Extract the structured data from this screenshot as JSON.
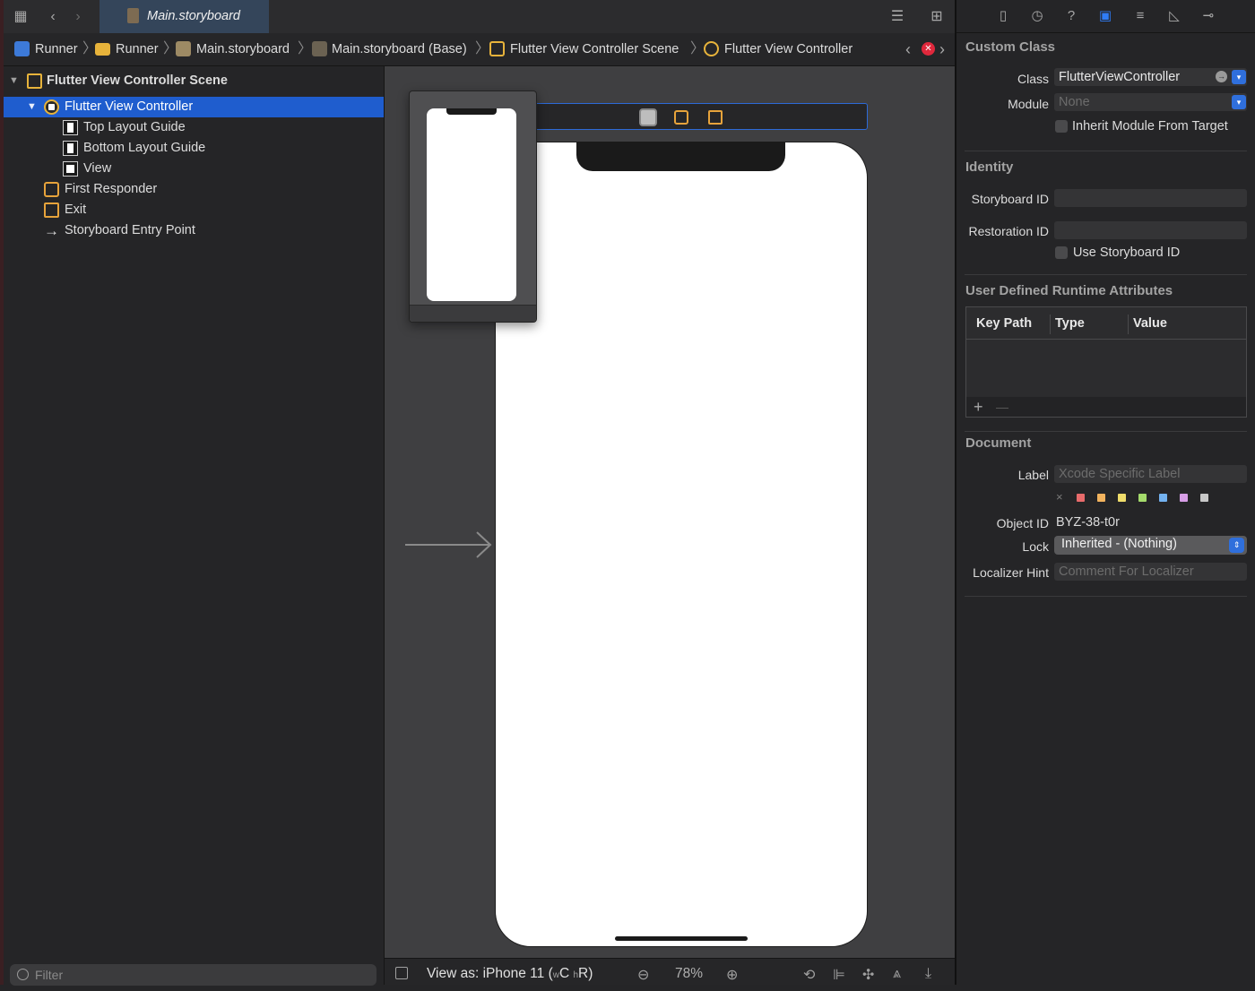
{
  "tabbar": {
    "active_tab": "Main.storyboard"
  },
  "breadcrumb": {
    "items": [
      "Runner",
      "Runner",
      "Main.storyboard",
      "Main.storyboard (Base)",
      "Flutter View Controller Scene",
      "Flutter View Controller"
    ]
  },
  "outline": {
    "rows": [
      "Flutter View Controller Scene",
      "Flutter View Controller",
      "Top Layout Guide",
      "Bottom Layout Guide",
      "View",
      "First Responder",
      "Exit",
      "Storyboard Entry Point"
    ],
    "selected_index": 1,
    "filter_placeholder": "Filter"
  },
  "canvas_toolbar": {
    "view_as": "View as: iPhone 11 (",
    "size_w": "w",
    "size_c": "C",
    "size_h": "h",
    "size_r": "R",
    "close_paren": ")",
    "zoom": "78%"
  },
  "inspector": {
    "custom_class": {
      "title": "Custom Class",
      "class_label": "Class",
      "class_value": "FlutterViewController",
      "module_label": "Module",
      "module_placeholder": "None",
      "inherit_label": "Inherit Module From Target"
    },
    "identity": {
      "title": "Identity",
      "storyboard_id_label": "Storyboard ID",
      "restoration_id_label": "Restoration ID",
      "use_storyboard_id_label": "Use Storyboard ID"
    },
    "runtime_attrs": {
      "title": "User Defined Runtime Attributes",
      "columns": [
        "Key Path",
        "Type",
        "Value"
      ],
      "add": "+",
      "remove": "—"
    },
    "document": {
      "title": "Document",
      "label_label": "Label",
      "label_placeholder": "Xcode Specific Label",
      "clear_glyph": "×",
      "object_id_label": "Object ID",
      "object_id_value": "BYZ-38-t0r",
      "lock_label": "Lock",
      "lock_value": "Inherited - (Nothing)",
      "localizer_hint_label": "Localizer Hint",
      "localizer_hint_placeholder": "Comment For Localizer"
    }
  },
  "colors": {
    "selection": "#1f5dce",
    "accent": "#2f6fdc",
    "scene_icon": "#e7b33b",
    "label_swatches": [
      "#e86b6b",
      "#f2b35e",
      "#f0dd6b",
      "#a5db6c",
      "#73b2f0",
      "#d79ee6",
      "#c8c8c8"
    ]
  }
}
